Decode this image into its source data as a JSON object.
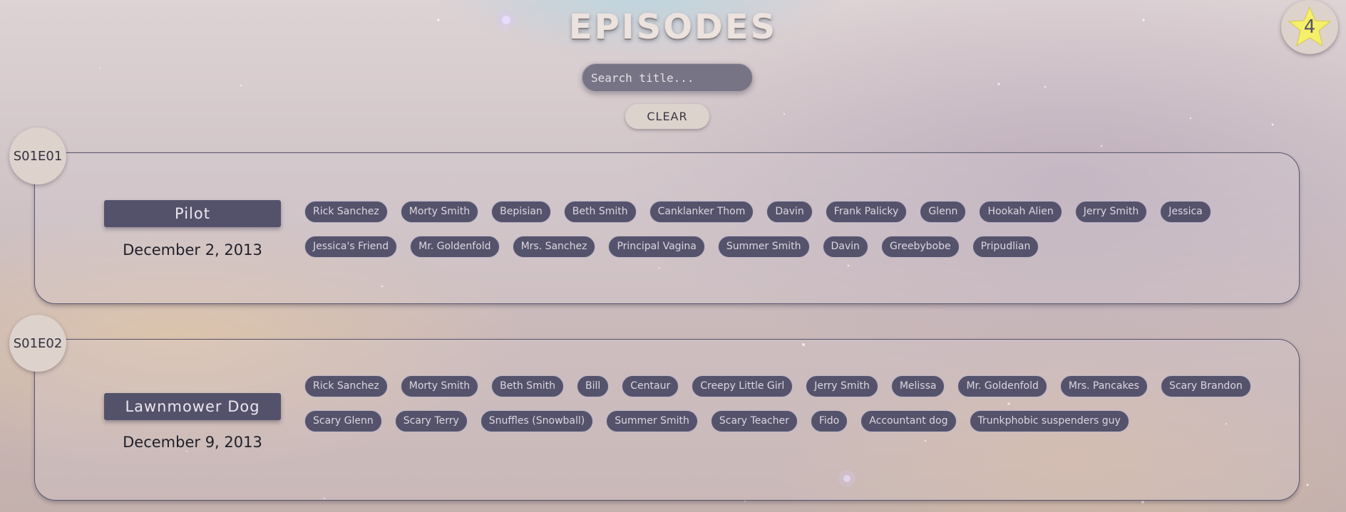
{
  "header": {
    "title": "EPISODES"
  },
  "favorites": {
    "count": "4",
    "icon": "star-icon",
    "color": "#f5ef6a"
  },
  "search": {
    "placeholder": "Search title...",
    "value": ""
  },
  "clear_label": "CLEAR",
  "episodes": [
    {
      "code": "S01E01",
      "name": "Pilot",
      "air_date": "December 2, 2013",
      "characters": [
        "Rick Sanchez",
        "Morty Smith",
        "Bepisian",
        "Beth Smith",
        "Canklanker Thom",
        "Davin",
        "Frank Palicky",
        "Glenn",
        "Hookah Alien",
        "Jerry Smith",
        "Jessica",
        "Jessica's Friend",
        "Mr. Goldenfold",
        "Mrs. Sanchez",
        "Principal Vagina",
        "Summer Smith",
        "Davin",
        "Greebybobe",
        "Pripudlian"
      ]
    },
    {
      "code": "S01E02",
      "name": "Lawnmower Dog",
      "air_date": "December 9, 2013",
      "characters": [
        "Rick Sanchez",
        "Morty Smith",
        "Beth Smith",
        "Bill",
        "Centaur",
        "Creepy Little Girl",
        "Jerry Smith",
        "Melissa",
        "Mr. Goldenfold",
        "Mrs. Pancakes",
        "Scary Brandon",
        "Scary Glenn",
        "Scary Terry",
        "Snuffles (Snowball)",
        "Summer Smith",
        "Scary Teacher",
        "Fido",
        "Accountant dog",
        "Trunkphobic suspenders guy"
      ]
    }
  ]
}
